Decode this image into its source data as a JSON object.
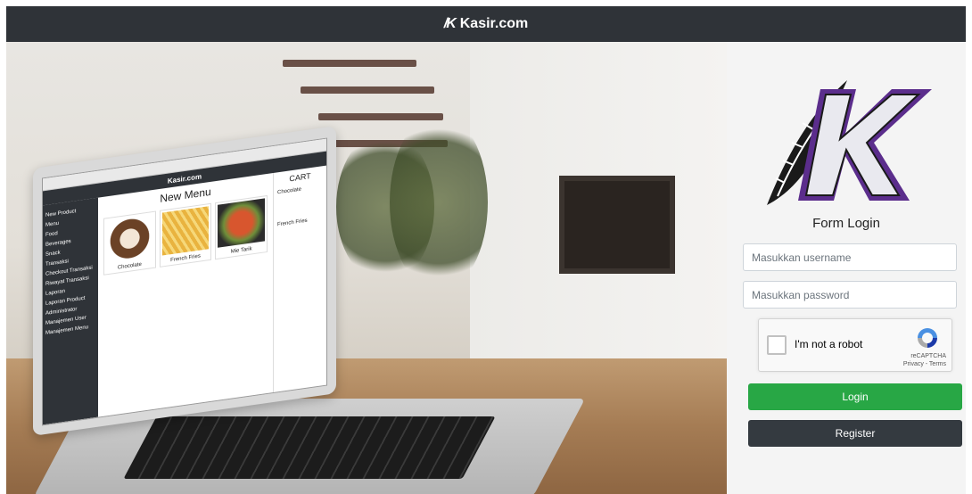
{
  "navbar": {
    "brand_mark": "/K",
    "brand_text": "Kasir.com"
  },
  "hero": {
    "laptop": {
      "brand_text": "Kasir.com",
      "page_title": "New Menu",
      "sidebar_items": [
        "New Product",
        "Menu",
        "Food",
        "Beverages",
        "Snack",
        "Transaksi",
        "Checkout Transaksi",
        "Riwayat Transaksi",
        "Laporan",
        "Laporan Product",
        "Administrator",
        "Manajemen User",
        "Manajemen Menu"
      ],
      "products": [
        "Chocolate",
        "French Fries",
        "Mie Tarik"
      ],
      "cart_title": "CART",
      "cart_items": [
        "Chocolate",
        "French Fries"
      ]
    }
  },
  "login": {
    "title": "Form Login",
    "username_placeholder": "Masukkan username",
    "password_placeholder": "Masukkan password",
    "recaptcha_label": "I'm not a robot",
    "recaptcha_brand": "reCAPTCHA",
    "recaptcha_links": "Privacy - Terms",
    "login_label": "Login",
    "register_label": "Register"
  },
  "colors": {
    "navbar": "#2f3338",
    "login_button": "#28a745",
    "register_button": "#343a40",
    "logo_accent": "#5b2d8c"
  }
}
